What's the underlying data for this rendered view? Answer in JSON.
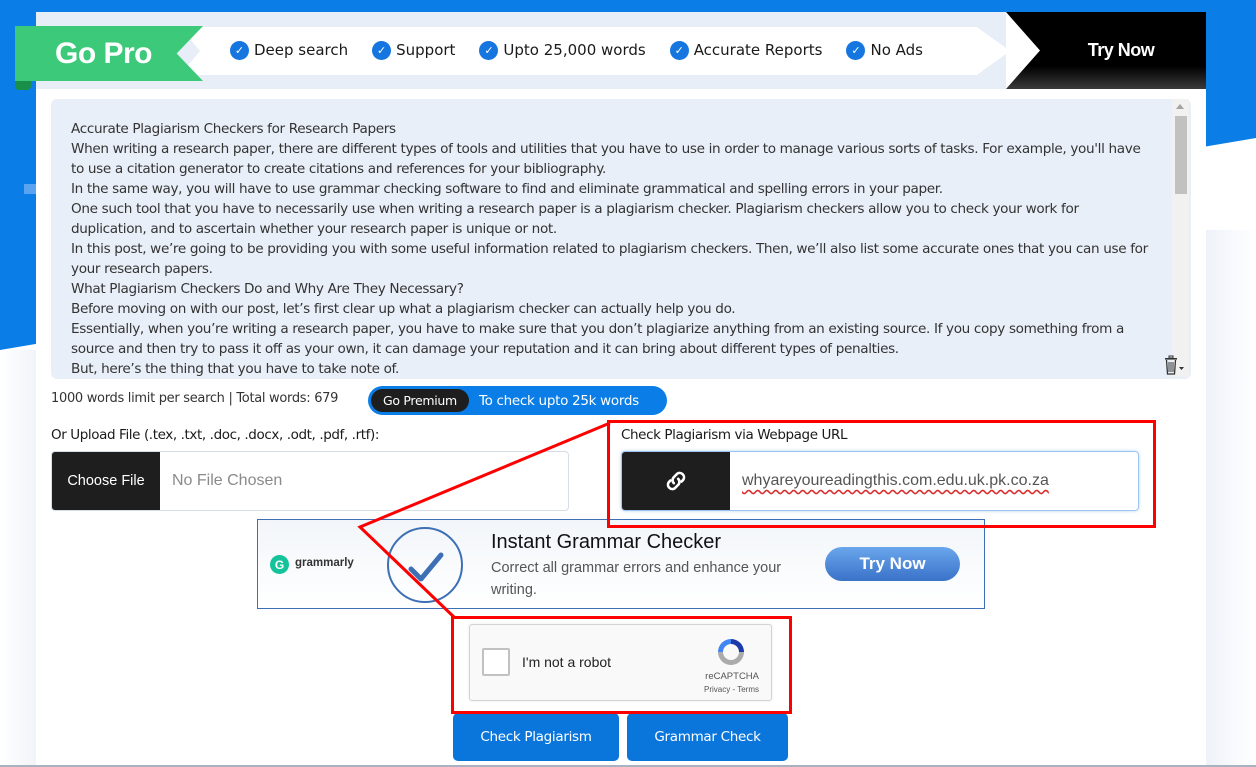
{
  "promo": {
    "go_pro_label": "Go Pro",
    "features": [
      "Deep search",
      "Support",
      "Upto 25,000 words",
      "Accurate Reports",
      "No Ads"
    ],
    "try_now_label": "Try Now"
  },
  "editor": {
    "lines": [
      "Accurate Plagiarism Checkers for Research Papers",
      "When writing a research paper, there are different types of tools and utilities that you have to use in order to manage various sorts of tasks. For example, you'll have to use a citation generator to create citations and references for your bibliography.",
      "In the same way, you will have to use grammar checking software to find and eliminate grammatical and spelling errors in your paper.",
      "One such tool that you have to necessarily use when writing a research paper is a plagiarism checker. Plagiarism checkers allow you to check your work for duplication, and to ascertain whether your research paper is unique or not.",
      "In this post, we’re going to be providing you with some useful information related to plagiarism checkers. Then, we’ll also list some accurate ones that you can use for your research papers.",
      "What Plagiarism Checkers Do and Why Are They Necessary?",
      "Before moving on with our post, let’s first clear up what a plagiarism checker can actually help you do.",
      "Essentially, when you’re writing a research paper, you have to make sure that you don’t plagiarize anything from an existing source. If you copy something from a source and then try to pass it off as your own, it can damage your reputation and it can bring about different types of penalties.",
      "But, here’s the thing that you have to take note of."
    ]
  },
  "word_info": {
    "text": "1000 words limit per search | Total words: 679",
    "premium_button": "Go Premium",
    "premium_text": "To check upto 25k words"
  },
  "upload": {
    "label": "Or Upload File (.tex, .txt, .doc, .docx, .odt, .pdf, .rtf):",
    "button": "Choose File",
    "status": "No File Chosen"
  },
  "url_check": {
    "label": "Check Plagiarism via Webpage URL",
    "value": "whyareyoureadingthis.com.edu.uk.pk.co.za"
  },
  "ad": {
    "brand": "grammarly",
    "title": "Instant Grammar Checker",
    "description": "Correct all grammar errors and enhance your writing.",
    "button": "Try Now"
  },
  "captcha": {
    "label": "I'm not a robot",
    "brand": "reCAPTCHA",
    "links": "Privacy - Terms"
  },
  "actions": {
    "check_plagiarism": "Check Plagiarism",
    "grammar_check": "Grammar Check"
  },
  "colors": {
    "brand_blue": "#0a7ee6",
    "go_pro_green": "#3dc97a",
    "annotation_red": "#ff0000"
  }
}
